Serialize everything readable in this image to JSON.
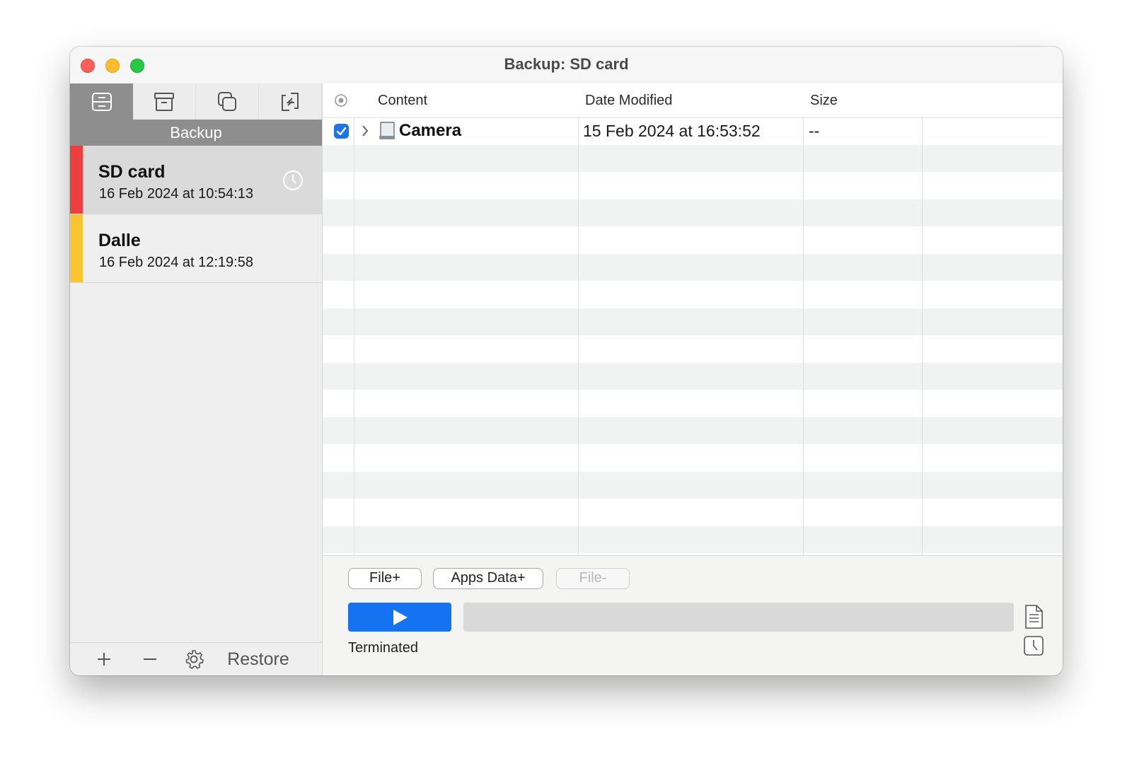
{
  "window": {
    "title": "Backup: SD card"
  },
  "sidebar": {
    "modes": [
      {
        "icon": "backup-icon",
        "active": true
      },
      {
        "icon": "archive-icon",
        "active": false
      },
      {
        "icon": "copy-icon",
        "active": false
      },
      {
        "icon": "sync-icon",
        "active": false
      }
    ],
    "mode_label": "Backup",
    "tasks": [
      {
        "name": "SD card",
        "date": "16 Feb 2024 at 10:54:13",
        "color": "#ec3f3f",
        "selected": true,
        "icon": "clock-icon"
      },
      {
        "name": "Dalle",
        "date": "16 Feb 2024 at 12:19:58",
        "color": "#f8c531",
        "selected": false
      }
    ],
    "bottom": {
      "add_icon": "plus-icon",
      "remove_icon": "minus-icon",
      "settings_icon": "gear-icon",
      "restore_label": "Restore"
    }
  },
  "table": {
    "columns": [
      "Content",
      "Date Modified",
      "Size"
    ],
    "rows": [
      {
        "checked": true,
        "name": "Camera",
        "date": "15 Feb 2024 at 16:53:52",
        "size": "--",
        "icon": "drive-icon"
      }
    ]
  },
  "footer": {
    "buttons": [
      {
        "label": "File+",
        "enabled": true
      },
      {
        "label": "Apps Data+",
        "enabled": true
      },
      {
        "label": "File-",
        "enabled": false
      }
    ],
    "play_icon": "play-icon",
    "progress": 0,
    "status": "Terminated",
    "side_icons": [
      "document-icon",
      "clock-icon"
    ]
  },
  "colors": {
    "accent": "#1572f0",
    "sidebar_header": "#8e8e8e"
  }
}
